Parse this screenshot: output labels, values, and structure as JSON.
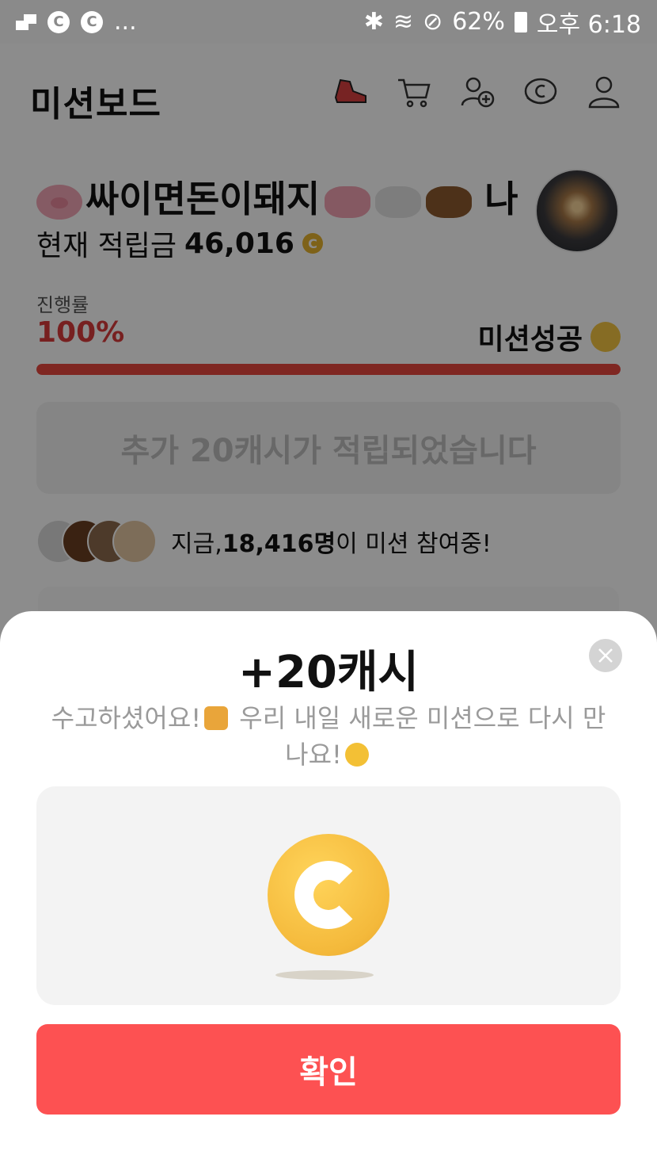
{
  "status_bar": {
    "battery": "62%",
    "time": "오후 6:18",
    "dots": "..."
  },
  "header": {
    "title": "미션보드",
    "icons": [
      "sneaker-icon",
      "cart-icon",
      "add-friend-icon",
      "cash-icon",
      "profile-icon"
    ]
  },
  "mission": {
    "name": "싸이면돈이돼지",
    "name_suffix": "나",
    "balance_label": "현재 적립금",
    "balance_value": "46,016",
    "coin_symbol": "C",
    "progress_label": "진행률",
    "progress_value": "100%",
    "progress_fraction": 1.0,
    "status": "미션성공",
    "extra_message": "추가 20캐시가 적립되었습니다"
  },
  "participants": {
    "prefix": "지금, ",
    "count": "18,416명",
    "suffix": "이 미션 참여중!"
  },
  "sheet": {
    "title": "+20캐시",
    "message_part1": "수고하셨어요!",
    "message_part2": " 우리 내일 새로운 미션으로 다시 만나요!",
    "confirm_label": "확인"
  },
  "colors": {
    "accent": "#fd5152",
    "progress": "#e8473f",
    "coin": "#f4b93b"
  }
}
